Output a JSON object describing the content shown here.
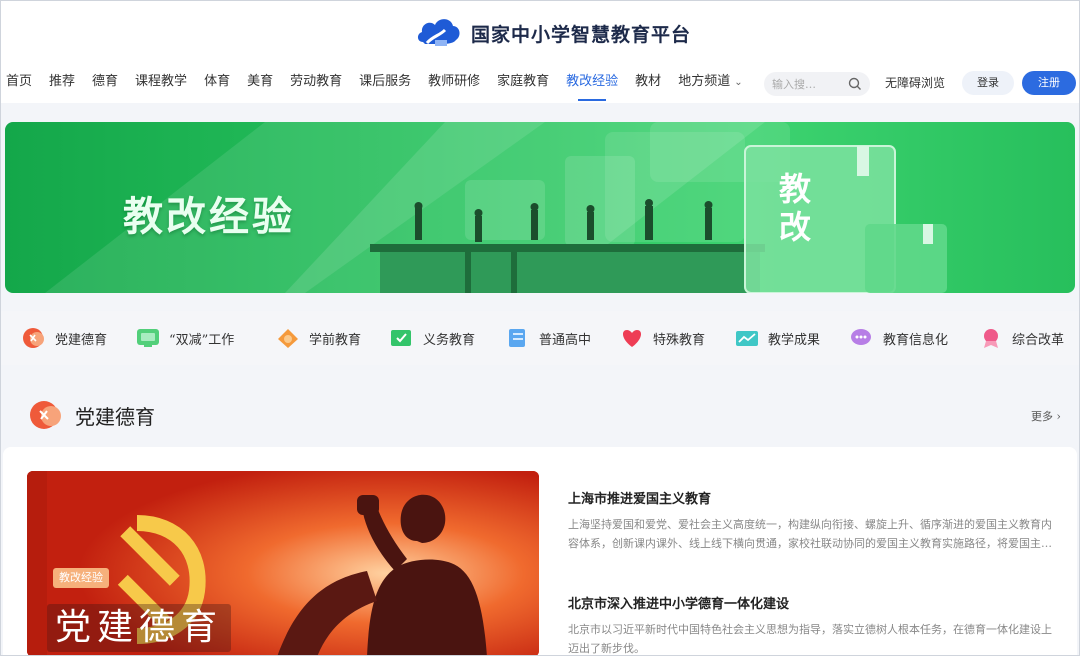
{
  "header": {
    "site_title": "国家中小学智慧教育平台",
    "nav": [
      {
        "label": "首页"
      },
      {
        "label": "推荐"
      },
      {
        "label": "德育"
      },
      {
        "label": "课程教学"
      },
      {
        "label": "体育"
      },
      {
        "label": "美育"
      },
      {
        "label": "劳动教育"
      },
      {
        "label": "课后服务"
      },
      {
        "label": "教师研修"
      },
      {
        "label": "家庭教育"
      },
      {
        "label": "教改经验",
        "active": true
      },
      {
        "label": "教材"
      },
      {
        "label": "地方频道"
      }
    ],
    "search_placeholder": "输入搜…",
    "accessibility_label": "无障碍浏览",
    "login_label": "登录",
    "register_label": "注册"
  },
  "banner": {
    "title": "教改经验",
    "book_text": "教改",
    "colors": {
      "bg": "#27bf5c"
    }
  },
  "categories": [
    {
      "label": "党建德育",
      "icon": "party-emblem-icon"
    },
    {
      "label": "“双减”工作",
      "icon": "monitor-icon"
    },
    {
      "label": "学前教育",
      "icon": "bell-icon"
    },
    {
      "label": "义务教育",
      "icon": "book-check-icon"
    },
    {
      "label": "普通高中",
      "icon": "document-icon"
    },
    {
      "label": "特殊教育",
      "icon": "heart-icon"
    },
    {
      "label": "教学成果",
      "icon": "chart-icon"
    },
    {
      "label": "教育信息化",
      "icon": "chat-icon"
    },
    {
      "label": "综合改革",
      "icon": "medal-icon"
    }
  ],
  "section": {
    "title": "党建德育",
    "more_label": "更多",
    "feature": {
      "tag": "教改经验",
      "caption": "党建德育"
    },
    "news": [
      {
        "title": "上海市推进爱国主义教育",
        "body": "上海坚持爱国和爱党、爱社会主义高度统一，构建纵向衔接、螺旋上升、循序渐进的爱国主义教育内容体系，创新课内课外、线上线下横向贯通，家校社联动协同的爱国主义教育实施路径，将爱国主…"
      },
      {
        "title": "北京市深入推进中小学德育一体化建设",
        "body": "北京市以习近平新时代中国特色社会主义思想为指导，落实立德树人根本任务，在德育一体化建设上迈出了新步伐。"
      }
    ]
  },
  "colors": {
    "accent": "#2a6ae0",
    "banner_green": "#27bf5c"
  }
}
